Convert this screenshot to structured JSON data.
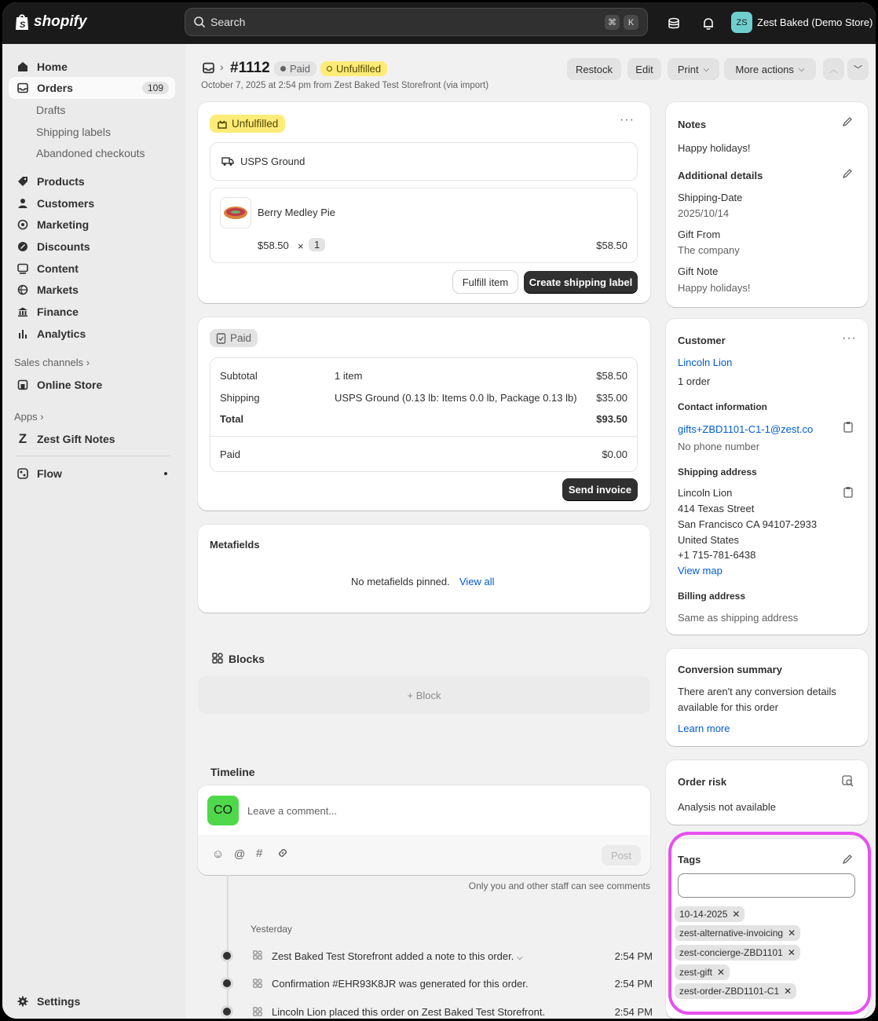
{
  "topbar": {
    "logo_text": "shopify",
    "search_placeholder": "Search",
    "shortcut_key1": "⌘",
    "shortcut_key2": "K",
    "avatar_initials": "ZS",
    "store_name": "Zest Baked (Demo Store)"
  },
  "sidebar": {
    "home": "Home",
    "orders": "Orders",
    "orders_count": "109",
    "drafts": "Drafts",
    "shipping_labels": "Shipping labels",
    "abandoned": "Abandoned checkouts",
    "products": "Products",
    "customers": "Customers",
    "marketing": "Marketing",
    "discounts": "Discounts",
    "content": "Content",
    "markets": "Markets",
    "finance": "Finance",
    "analytics": "Analytics",
    "sales_channels": "Sales channels",
    "online_store": "Online Store",
    "apps": "Apps",
    "zest_gift_notes": "Zest Gift Notes",
    "flow": "Flow",
    "settings": "Settings"
  },
  "header": {
    "order_number": "#1112",
    "paid_badge": "Paid",
    "unfulfilled_badge": "Unfulfilled",
    "subtitle": "October 7, 2025 at 2:54 pm from Zest Baked Test Storefront (via import)",
    "restock": "Restock",
    "edit": "Edit",
    "print": "Print",
    "more_actions": "More actions"
  },
  "fulfillment": {
    "status": "Unfulfilled",
    "method": "USPS Ground",
    "item_name": "Berry Medley Pie",
    "item_price": "$58.50",
    "times": "×",
    "item_qty": "1",
    "item_total": "$58.50",
    "fulfill_btn": "Fulfill item",
    "shipping_label_btn": "Create shipping label"
  },
  "payment": {
    "status": "Paid",
    "subtotal_label": "Subtotal",
    "subtotal_desc": "1 item",
    "subtotal_value": "$58.50",
    "shipping_label": "Shipping",
    "shipping_desc": "USPS Ground (0.13 lb: Items 0.0 lb, Package 0.13 lb)",
    "shipping_value": "$35.00",
    "total_label": "Total",
    "total_value": "$93.50",
    "paid_label": "Paid",
    "paid_value": "$0.00",
    "send_invoice": "Send invoice"
  },
  "metafields": {
    "title": "Metafields",
    "empty_text": "No metafields pinned.",
    "view_all": "View all"
  },
  "blocks": {
    "title": "Blocks",
    "add_block": "+ Block"
  },
  "timeline": {
    "title": "Timeline",
    "avatar": "CO",
    "comment_placeholder": "Leave a comment...",
    "post": "Post",
    "staff_note": "Only you and other staff can see comments",
    "day": "Yesterday",
    "events": [
      {
        "text": "Zest Baked Test Storefront added a note to this order.",
        "time": "2:54 PM"
      },
      {
        "text": "Confirmation #EHR93K8JR was generated for this order.",
        "time": "2:54 PM"
      },
      {
        "text": "Lincoln Lion placed this order on Zest Baked Test Storefront.",
        "time": "2:54 PM"
      }
    ]
  },
  "notes": {
    "title": "Notes",
    "text": "Happy holidays!",
    "additional_title": "Additional details",
    "shipping_date_label": "Shipping-Date",
    "shipping_date_value": "2025/10/14",
    "gift_from_label": "Gift From",
    "gift_from_value": "The company",
    "gift_note_label": "Gift Note",
    "gift_note_value": "Happy holidays!"
  },
  "customer": {
    "title": "Customer",
    "name": "Lincoln Lion",
    "orders": "1 order",
    "contact_title": "Contact information",
    "email": "gifts+ZBD1101-C1-1@zest.co",
    "phone": "No phone number",
    "shipping_title": "Shipping address",
    "ship_name": "Lincoln Lion",
    "ship_street": "414 Texas Street",
    "ship_city": "San Francisco CA 94107-2933",
    "ship_country": "United States",
    "ship_phone": "+1 715-781-6438",
    "view_map": "View map",
    "billing_title": "Billing address",
    "billing_text": "Same as shipping address"
  },
  "conversion": {
    "title": "Conversion summary",
    "line1": "There aren't any conversion details",
    "line2": "available for this order",
    "learn_more": "Learn more"
  },
  "risk": {
    "title": "Order risk",
    "text": "Analysis not available"
  },
  "tags": {
    "title": "Tags",
    "items": [
      "10-14-2025",
      "zest-alternative-invoicing",
      "zest-concierge-ZBD1101",
      "zest-gift",
      "zest-order-ZBD1101-C1"
    ]
  },
  "colors": {
    "highlight": "#e84ff0",
    "unfulfilled_bg": "#ffeb78",
    "link": "#005bd3",
    "timeline_avatar": "#4fd84a"
  }
}
